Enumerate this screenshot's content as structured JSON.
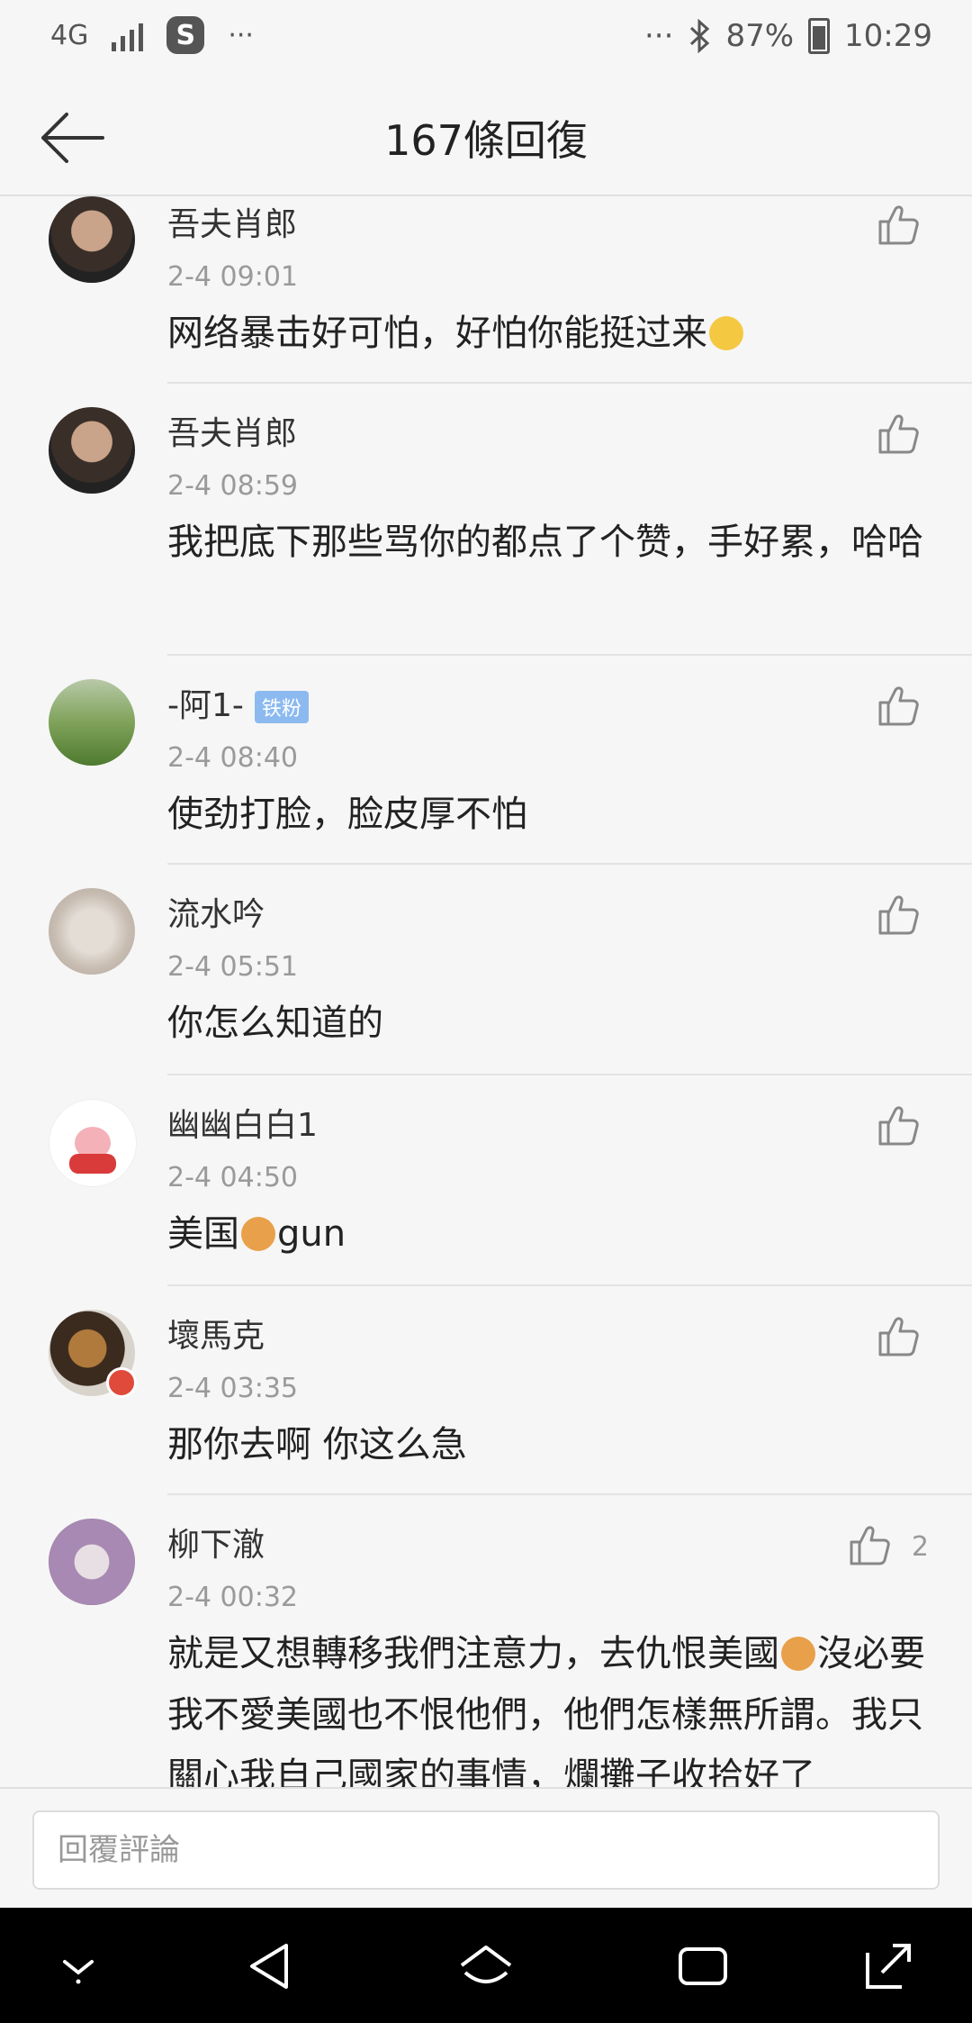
{
  "status": {
    "network": "4G",
    "icons": [
      "signal-icon",
      "s-app-icon",
      "more-dots-icon",
      "bluetooth-icon",
      "battery-icon"
    ],
    "app_letter": "S",
    "dots_left": "···",
    "dots_right": "···",
    "battery": "87%",
    "time": "10:29"
  },
  "header": {
    "title": "167條回復"
  },
  "comments": [
    {
      "user": "吾夫肖郎",
      "time": "2-4 09:01",
      "text": "网络暴击好可怕，好怕你能挺过来",
      "likes": ""
    },
    {
      "user": "吾夫肖郎",
      "time": "2-4 08:59",
      "text": "我把底下那些骂你的都点了个赞，手好累，哈哈",
      "likes": ""
    },
    {
      "user": "-阿1-",
      "badge": "铁粉",
      "time": "2-4 08:40",
      "text": "使劲打脸，脸皮厚不怕",
      "likes": ""
    },
    {
      "user": "流水吟",
      "time": "2-4 05:51",
      "text": "你怎么知道的",
      "likes": ""
    },
    {
      "user": "幽幽白白1",
      "time": "2-4 04:50",
      "text_a": "美国",
      "text_b": "gun",
      "likes": ""
    },
    {
      "user": "壞馬克",
      "time": "2-4 03:35",
      "text": "那你去啊 你这么急",
      "likes": ""
    },
    {
      "user": "柳下澈",
      "time": "2-4 00:32",
      "text_a": "就是又想轉移我們注意力，去仇恨美國",
      "text_b": "沒必要我不愛美國也不恨他們，他們怎樣無所謂。我只關心我自己國家的事情，爛攤子收拾好了",
      "likes": "2"
    }
  ],
  "reply": {
    "placeholder": "回覆評論"
  },
  "colors": {
    "background": "#f6f6f6",
    "badge": "#8cbaf0",
    "navbar": "#000000"
  }
}
